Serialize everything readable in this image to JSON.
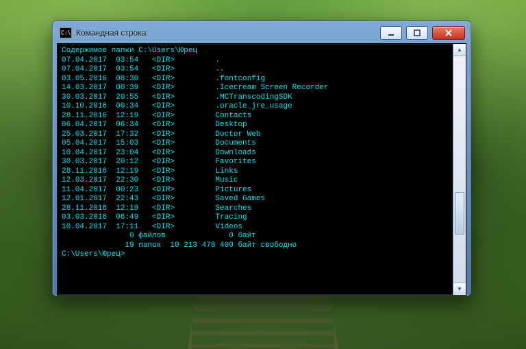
{
  "window": {
    "title": "Командная строка",
    "icon_name": "cmd-icon"
  },
  "colors": {
    "terminal_fg": "#00e5ee",
    "terminal_bg": "#000000",
    "frame_top": "#7ea9d6",
    "frame_bottom": "#4d79a8",
    "close_btn": "#c83220"
  },
  "terminal": {
    "header": "Содержимое папки C:\\Users\\Юрец",
    "dir_tag": "<DIR>",
    "entries": [
      {
        "date": "07.04.2017",
        "time": "03:54",
        "name": "."
      },
      {
        "date": "07.04.2017",
        "time": "03:54",
        "name": ".."
      },
      {
        "date": "03.05.2016",
        "time": "08:30",
        "name": ".fontconfig"
      },
      {
        "date": "14.03.2017",
        "time": "00:39",
        "name": ".Icecream Screen Recorder"
      },
      {
        "date": "30.03.2017",
        "time": "20:55",
        "name": ".MCTranscodingSDK"
      },
      {
        "date": "10.10.2016",
        "time": "00:34",
        "name": ".oracle_jre_usage"
      },
      {
        "date": "28.11.2016",
        "time": "12:19",
        "name": "Contacts"
      },
      {
        "date": "06.04.2017",
        "time": "06:34",
        "name": "Desktop"
      },
      {
        "date": "25.03.2017",
        "time": "17:32",
        "name": "Doctor Web"
      },
      {
        "date": "05.04.2017",
        "time": "15:03",
        "name": "Documents"
      },
      {
        "date": "10.04.2017",
        "time": "23:04",
        "name": "Downloads"
      },
      {
        "date": "30.03.2017",
        "time": "20:12",
        "name": "Favorites"
      },
      {
        "date": "28.11.2016",
        "time": "12:19",
        "name": "Links"
      },
      {
        "date": "12.03.2017",
        "time": "22:30",
        "name": "Music"
      },
      {
        "date": "11.04.2017",
        "time": "00:23",
        "name": "Pictures"
      },
      {
        "date": "12.01.2017",
        "time": "22:43",
        "name": "Saved Games"
      },
      {
        "date": "28.11.2016",
        "time": "12:19",
        "name": "Searches"
      },
      {
        "date": "03.03.2016",
        "time": "06:49",
        "name": "Tracing"
      },
      {
        "date": "10.04.2017",
        "time": "17:11",
        "name": "Videos"
      }
    ],
    "summary1": "               0 файлов              0 байт",
    "summary2": "              19 папок  10 213 478 400 байт свободно",
    "prompt": "C:\\Users\\Юрец>"
  }
}
